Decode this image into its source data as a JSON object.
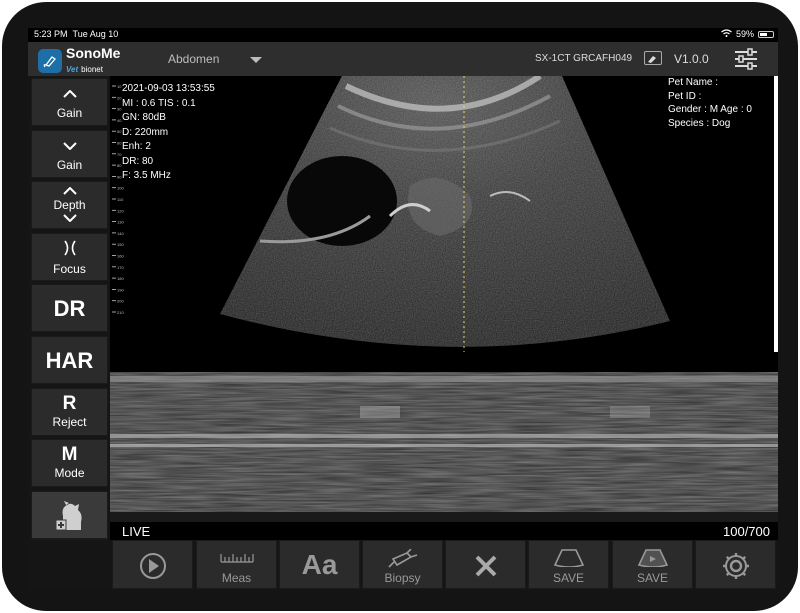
{
  "status_bar": {
    "time": "5:23 PM",
    "date": "Tue Aug 10",
    "battery": "59%",
    "battery_level": 0.59
  },
  "header": {
    "brand": "SonoMe",
    "brand_sub_vet": "Vet",
    "brand_sub": "bionet",
    "preset": "Abdomen",
    "probe_id": "SX-1CT GRCAFH049",
    "version": "V1.0.0"
  },
  "left_toolbar": {
    "gain_up": "Gain",
    "gain_down": "Gain",
    "depth": "Depth",
    "focus": "Focus",
    "dr": "DR",
    "har": "HAR",
    "reject_big": "R",
    "reject": "Reject",
    "mode_big": "M",
    "mode": "Mode"
  },
  "image_info": {
    "datetime": "2021-09-03 13:53:55",
    "mi_tis": "MI : 0.6  TIS : 0.1",
    "gain": "GN: 80dB",
    "depth": "D: 220mm",
    "enhance": "Enh: 2",
    "dynamic_range": "DR: 80",
    "frequency": "F: 3.5 MHz"
  },
  "patient": {
    "pet_name": "Pet Name :",
    "pet_id": "Pet ID :",
    "gender_age": "Gender : M   Age : 0",
    "species": "Species : Dog"
  },
  "depth_scale": [
    "10",
    "20",
    "30",
    "40",
    "50",
    "60",
    "70",
    "80",
    "90",
    "100",
    "110",
    "120",
    "130",
    "140",
    "150",
    "160",
    "170",
    "180",
    "190",
    "200",
    "210"
  ],
  "mmode_status": {
    "state": "LIVE",
    "frame": "100/700"
  },
  "bottom_toolbar": {
    "meas": "Meas",
    "text": "Aa",
    "biopsy": "Biopsy",
    "save_image": "SAVE",
    "save_clip": "SAVE"
  },
  "colors": {
    "button_bg": "#2b2b2b",
    "header_bg": "#2e2e2e",
    "brand_blue": "#1e6fa8"
  }
}
